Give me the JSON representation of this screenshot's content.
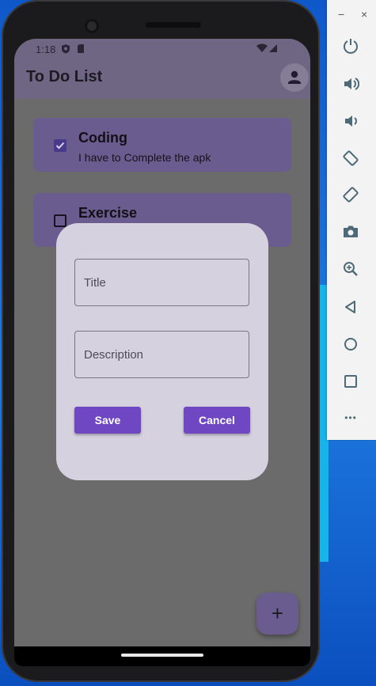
{
  "status_bar": {
    "time": "1:18"
  },
  "app_bar": {
    "title": "To Do List"
  },
  "todos": [
    {
      "title": "Coding",
      "description": "I have to Complete the apk",
      "checked": true
    },
    {
      "title": "Exercise",
      "description": "",
      "checked": false
    }
  ],
  "dialog": {
    "title_placeholder": "Title",
    "description_placeholder": "Description",
    "save_label": "Save",
    "cancel_label": "Cancel"
  },
  "fab": {
    "label": "+"
  },
  "emulator": {
    "minimize_label": "−",
    "close_label": "×",
    "more_label": "•••"
  },
  "colors": {
    "app_bar": "#6f6684",
    "card": "#6a5c8e",
    "checkbox_checked": "#4a3a8c",
    "button": "#6f47c2",
    "dialog": "#d6d1df",
    "emulator_icon": "#4e6a78"
  }
}
